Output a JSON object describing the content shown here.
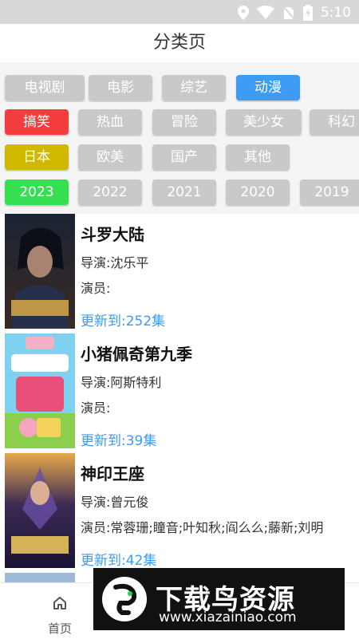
{
  "status": {
    "time": "5:10"
  },
  "header": {
    "title": "分类页"
  },
  "filters": {
    "types": [
      "电视剧",
      "电影",
      "综艺",
      "动漫"
    ],
    "genres": [
      "搞笑",
      "热血",
      "冒险",
      "美少女",
      "科幻"
    ],
    "regions": [
      "日本",
      "欧美",
      "国产",
      "其他"
    ],
    "years": [
      "2023",
      "2022",
      "2021",
      "2020",
      "2019"
    ]
  },
  "items": [
    {
      "title": "斗罗大陆",
      "director": "导演:沈乐平",
      "actors": "演员:",
      "update": "更新到:252集"
    },
    {
      "title": "小猪佩奇第九季",
      "director": "导演:阿斯特利",
      "actors": "演员:",
      "update": "更新到:39集"
    },
    {
      "title": "神印王座",
      "director": "导演:曾元俊",
      "actors": "演员:常蓉珊;瞳音;叶知秋;阎么么;藤新;刘明",
      "update": "更新到:42集"
    }
  ],
  "nav": {
    "home": "首页"
  },
  "banner": {
    "title": "下载鸟资源",
    "url": "www.xiazainiao.com"
  },
  "colors": {
    "accent": "#3d9bf3",
    "red": "#f43d3d",
    "olive": "#cfb800",
    "green": "#36de52",
    "inactive": "#c9c9c9"
  }
}
